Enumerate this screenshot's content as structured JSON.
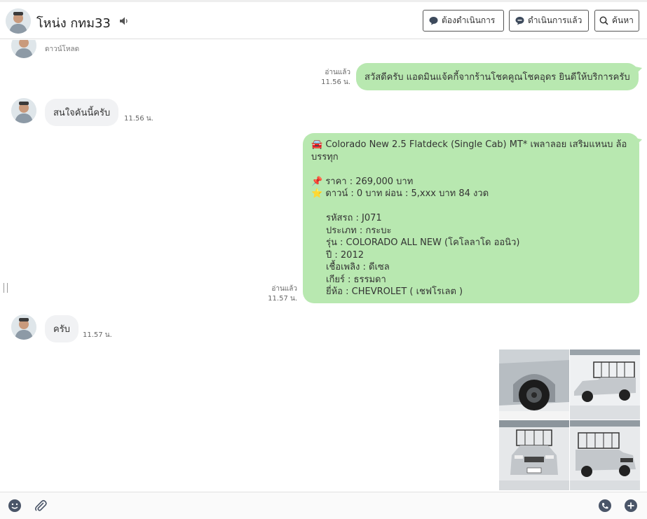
{
  "header": {
    "contact_name": "โหน่ง  กทม33",
    "buttons": {
      "todo_label": "ต้องดำเนินการ",
      "done_label": "ดำเนินการแล้ว",
      "search_label": "ค้นหา"
    }
  },
  "messages": {
    "download_label": "ดาวน์โหลด",
    "greeting": {
      "text": "สวัสดีครับ แอดมินแจ้คกี้จากร้านโชคคูณโชคอุดร ยินดีให้บริการครับ",
      "read_label": "อ่านแล้ว",
      "time": "11.56 น."
    },
    "interest": {
      "text": "สนใจคันนี้ครับ",
      "time": "11.56 น."
    },
    "listing": {
      "title": "Colorado New 2.5 Flatdeck (Single Cab) MT* เพลาลอย เสริมแหนบ ล้อ",
      "title_cont": "บรรทุก",
      "price": "ราคา : 269,000 บาท",
      "down": "ดาวน์ : 0 บาท ผ่อน : 5,xxx บาท 84 งวด",
      "code": "รหัสรถ : J071",
      "type": "ประเภท : กระบะ",
      "model": "รุ่น : COLORADO ALL NEW (โคโลลาโด ออนิว)",
      "year": "ปี : 2012",
      "fuel": "เชื้อเพลิง : ดีเซล",
      "gear": "เกียร์ : ธรรมดา",
      "brand": "ยี่ห้อ : CHEVROLET ( เชฟโรเลต )",
      "read_label": "อ่านแล้ว",
      "time": "11.57 น."
    },
    "reply": {
      "text": "ครับ",
      "time": "11.57 น."
    }
  },
  "icons": {
    "speaker": "speaker-icon",
    "todo": "chat-bubble-icon",
    "done": "chat-check-icon",
    "search": "search-icon",
    "car": "car-emoji",
    "pin": "pushpin-emoji",
    "star": "star-emoji",
    "emoji": "smiley-icon",
    "attach": "paperclip-icon",
    "sticker": "sticker-icon",
    "more": "plus-bubble-icon"
  },
  "colors": {
    "outgoing_bubble": "#b8e8b0",
    "incoming_bubble": "#f1f2f4"
  }
}
